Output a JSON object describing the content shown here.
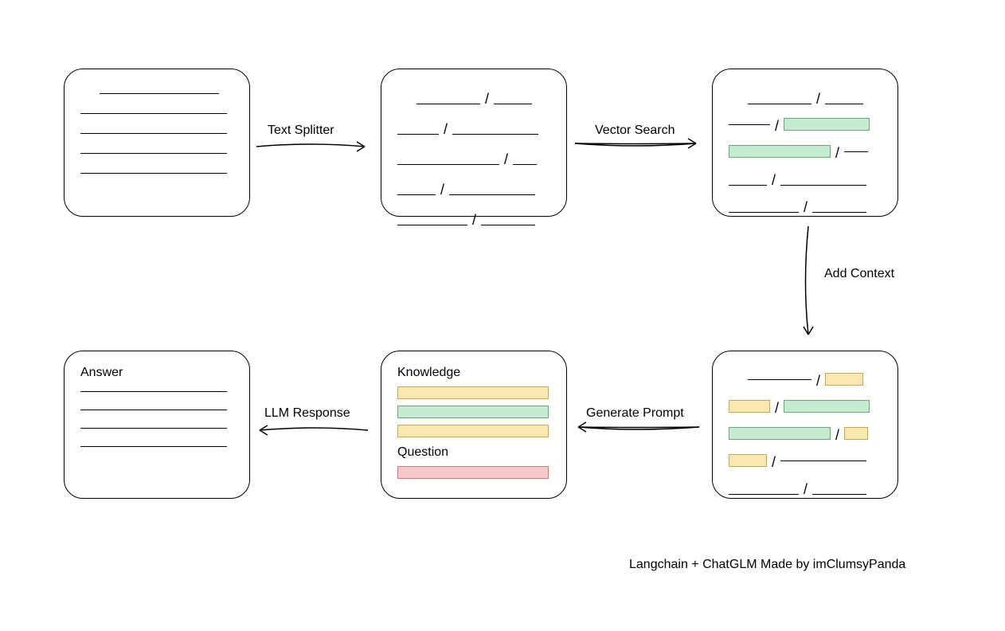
{
  "arrows": {
    "text_splitter": "Text Splitter",
    "vector_search": "Vector Search",
    "add_context": "Add Context",
    "generate_prompt": "Generate Prompt",
    "llm_response": "LLM Response"
  },
  "box_labels": {
    "knowledge": "Knowledge",
    "question": "Question",
    "answer": "Answer"
  },
  "footer": "Langchain + ChatGLM Made by imClumsyPanda"
}
